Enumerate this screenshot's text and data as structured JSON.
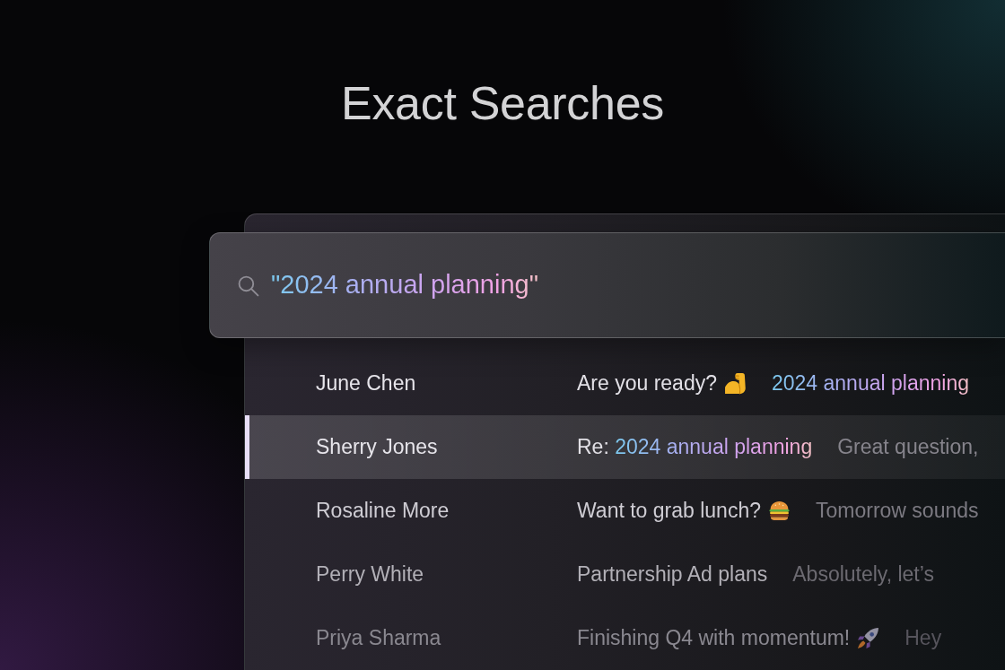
{
  "title": "Exact Searches",
  "search": {
    "value": "\"2024 annual planning\""
  },
  "results": [
    {
      "sender": "June Chen",
      "selected": false,
      "subject": [
        {
          "text": "Are you ready?",
          "highlight": false
        }
      ],
      "emoji": {
        "kind": "muscle"
      },
      "preview": [
        {
          "text": "2024 annual planning",
          "highlight": true
        }
      ]
    },
    {
      "sender": "Sherry Jones",
      "selected": true,
      "subject": [
        {
          "text": "Re: ",
          "highlight": false
        },
        {
          "text": "2024 annual planning",
          "highlight": true
        }
      ],
      "preview": [
        {
          "text": "Great question,",
          "highlight": false
        }
      ]
    },
    {
      "sender": "Rosaline More",
      "selected": false,
      "subject": [
        {
          "text": "Want to grab lunch?",
          "highlight": false
        }
      ],
      "emoji": {
        "kind": "burger"
      },
      "preview": [
        {
          "text": "Tomorrow sounds",
          "highlight": false
        }
      ]
    },
    {
      "sender": "Perry White",
      "selected": false,
      "subject": [
        {
          "text": "Partnership Ad plans",
          "highlight": false
        }
      ],
      "preview": [
        {
          "text": "Absolutely, let’s",
          "highlight": false
        }
      ]
    },
    {
      "sender": "Priya Sharma",
      "selected": false,
      "subject": [
        {
          "text": "Finishing Q4 with momentum!",
          "highlight": false
        }
      ],
      "emoji": {
        "kind": "rocket"
      },
      "preview": [
        {
          "text": "Hey",
          "highlight": false
        }
      ]
    }
  ]
}
